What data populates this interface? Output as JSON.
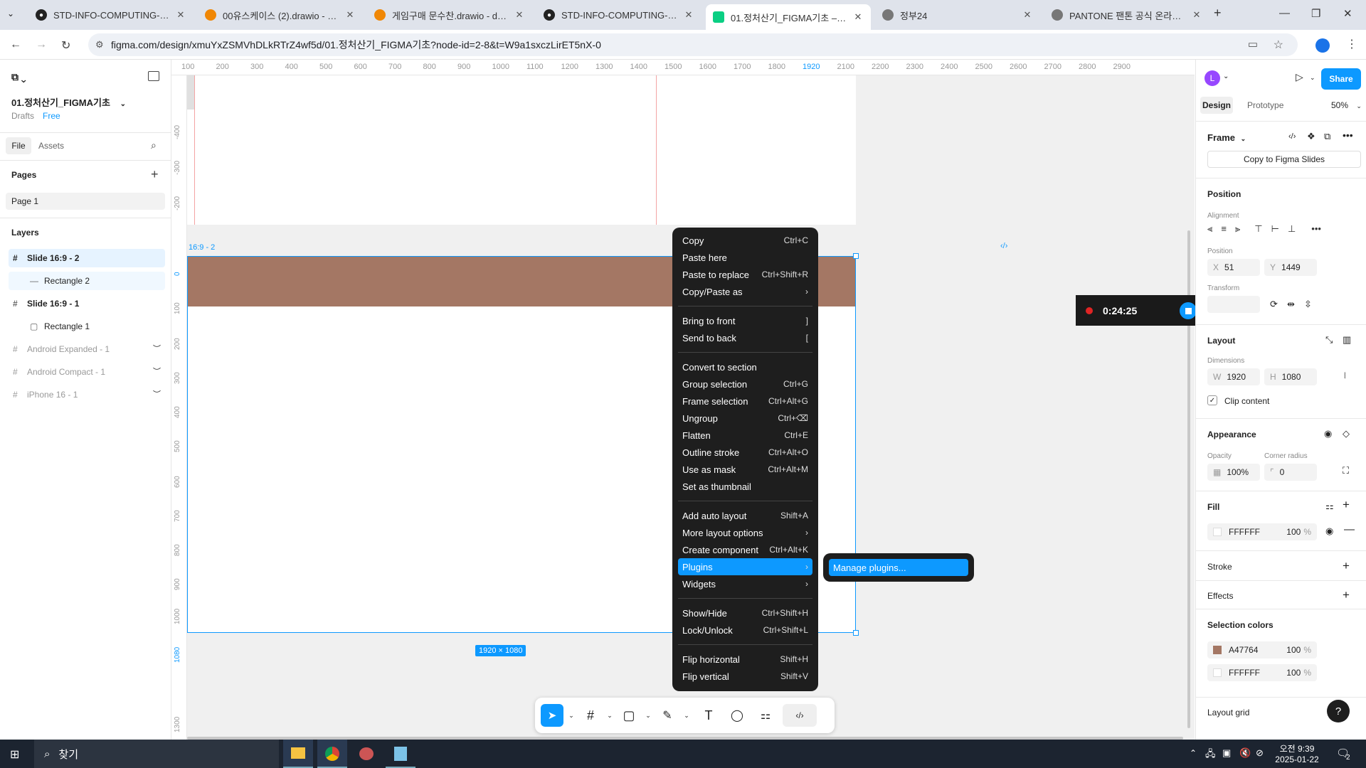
{
  "browser": {
    "tabs": [
      {
        "title": "STD-INFO-COMPUTING-WEB-",
        "icon": "github-icon"
      },
      {
        "title": "00유스케이스 (2).drawio - dra",
        "icon": "drawio-icon"
      },
      {
        "title": "게임구매 문수찬.drawio - draw",
        "icon": "drawio-icon"
      },
      {
        "title": "STD-INFO-COMPUTING-WEB-",
        "icon": "github-icon"
      },
      {
        "title": "01.정처산기_FIGMA기초 – Figr",
        "icon": "figma-icon"
      },
      {
        "title": "정부24",
        "icon": "globe-icon"
      },
      {
        "title": "PANTONE 팬톤 공식 온라인 스",
        "icon": "globe-icon"
      }
    ],
    "url": "figma.com/design/xmuYxZSMVhDLkRTrZ4wf5d/01.정처산기_FIGMA기초?node-id=2-8&t=W9a1sxczLirET5nX-0"
  },
  "left": {
    "file_name": "01.정처산기_FIGMA기초",
    "drafts": "Drafts",
    "plan": "Free",
    "tabs": [
      "File",
      "Assets"
    ],
    "pages_title": "Pages",
    "pages": [
      "Page 1"
    ],
    "layers_title": "Layers",
    "layers": [
      {
        "name": "Slide 16:9 - 2",
        "icon": "frame-icon"
      },
      {
        "name": "Rectangle 2",
        "icon": "line-icon"
      },
      {
        "name": "Slide 16:9 - 1",
        "icon": "frame-icon"
      },
      {
        "name": "Rectangle 1",
        "icon": "rectangle-icon"
      },
      {
        "name": "Android Expanded - 1",
        "icon": "frame-icon"
      },
      {
        "name": "Android Compact - 1",
        "icon": "frame-icon"
      },
      {
        "name": "iPhone 16 - 1",
        "icon": "frame-icon"
      }
    ]
  },
  "canvas": {
    "ruler_top": [
      "100",
      "200",
      "300",
      "400",
      "500",
      "600",
      "700",
      "800",
      "900",
      "1000",
      "1100",
      "1200",
      "1300",
      "1400",
      "1500",
      "1600",
      "1700",
      "1800",
      "1920",
      "2100",
      "2200",
      "2300",
      "2400",
      "2500",
      "2600",
      "2700",
      "2800",
      "2900"
    ],
    "ruler_left": [
      "-400",
      "-300",
      "-200",
      "0",
      "100",
      "200",
      "300",
      "400",
      "500",
      "600",
      "700",
      "800",
      "900",
      "1000",
      "1080",
      "1300"
    ],
    "frame_label": "16:9 - 2",
    "frame_size": "1920 × 1080",
    "rect_color": "#A47764"
  },
  "context_menu": {
    "groups": [
      [
        {
          "label": "Copy",
          "key": "Ctrl+C"
        },
        {
          "label": "Paste here",
          "key": ""
        },
        {
          "label": "Paste to replace",
          "key": "Ctrl+Shift+R"
        },
        {
          "label": "Copy/Paste as",
          "key": "›"
        }
      ],
      [
        {
          "label": "Bring to front",
          "key": "]"
        },
        {
          "label": "Send to back",
          "key": "["
        }
      ],
      [
        {
          "label": "Convert to section",
          "key": ""
        },
        {
          "label": "Group selection",
          "key": "Ctrl+G"
        },
        {
          "label": "Frame selection",
          "key": "Ctrl+Alt+G"
        },
        {
          "label": "Ungroup",
          "key": "Ctrl+⌫"
        },
        {
          "label": "Flatten",
          "key": "Ctrl+E"
        },
        {
          "label": "Outline stroke",
          "key": "Ctrl+Alt+O"
        },
        {
          "label": "Use as mask",
          "key": "Ctrl+Alt+M"
        },
        {
          "label": "Set as thumbnail",
          "key": ""
        }
      ],
      [
        {
          "label": "Add auto layout",
          "key": "Shift+A"
        },
        {
          "label": "More layout options",
          "key": "›"
        },
        {
          "label": "Create component",
          "key": "Ctrl+Alt+K"
        },
        {
          "label": "Plugins",
          "key": "›"
        },
        {
          "label": "Widgets",
          "key": "›"
        }
      ],
      [
        {
          "label": "Show/Hide",
          "key": "Ctrl+Shift+H"
        },
        {
          "label": "Lock/Unlock",
          "key": "Ctrl+Shift+L"
        }
      ],
      [
        {
          "label": "Flip horizontal",
          "key": "Shift+H"
        },
        {
          "label": "Flip vertical",
          "key": "Shift+V"
        }
      ]
    ],
    "submenu": "Manage plugins..."
  },
  "recorder": {
    "time": "0:24:25"
  },
  "right": {
    "avatar": "L",
    "share": "Share",
    "tabs": [
      "Design",
      "Prototype"
    ],
    "zoom": "50%",
    "frame_title": "Frame",
    "copy_slides": "Copy to Figma Slides",
    "position_title": "Position",
    "alignment_label": "Alignment",
    "position_label": "Position",
    "x": "51",
    "y": "1449",
    "transform_label": "Transform",
    "layout_title": "Layout",
    "dimensions_label": "Dimensions",
    "w": "1920",
    "h": "1080",
    "clip_content": "Clip content",
    "appearance_title": "Appearance",
    "opacity_label": "Opacity",
    "corner_label": "Corner radius",
    "opacity": "100%",
    "corner": "0",
    "fill_title": "Fill",
    "fill_hex": "FFFFFF",
    "fill_opacity": "100",
    "stroke_title": "Stroke",
    "effects_title": "Effects",
    "selection_colors_title": "Selection colors",
    "selection_colors": [
      {
        "hex": "A47764",
        "opacity": "100",
        "swatch": "#A47764"
      },
      {
        "hex": "FFFFFF",
        "opacity": "100",
        "swatch": "#FFFFFF"
      }
    ],
    "layout_grid_title": "Layout grid",
    "percent": "%"
  },
  "taskbar": {
    "search": "찾기",
    "time": "오전 9:39",
    "date": "2025-01-22",
    "notif_count": "2"
  }
}
